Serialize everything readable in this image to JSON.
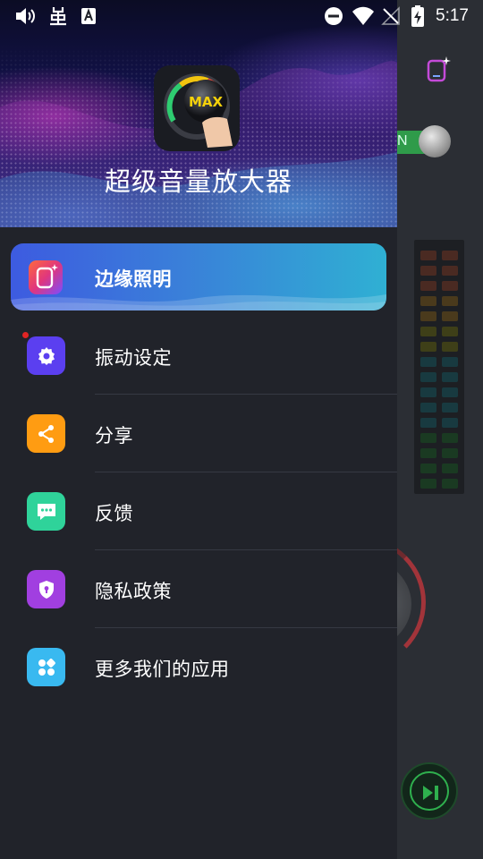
{
  "status_bar": {
    "time": "5:17",
    "left_icons": [
      "volume-icon",
      "bug-icon",
      "font-app-icon"
    ],
    "right_icons": [
      "dnd-icon",
      "wifi-icon",
      "no-signal-icon",
      "battery-charging-icon"
    ]
  },
  "drawer": {
    "app_name": "超级音量放大器",
    "logo_text": "MAX",
    "active_item": {
      "label": "边缘照明",
      "icon": "edge-lighting-icon"
    },
    "items": [
      {
        "label": "振动设定",
        "icon": "gear-icon",
        "color": "#5b3ff0",
        "has_dot": true
      },
      {
        "label": "分享",
        "icon": "share-icon",
        "color": "#ff9c12",
        "has_dot": false
      },
      {
        "label": "反馈",
        "icon": "chat-icon",
        "color": "#2fd39a",
        "has_dot": false
      },
      {
        "label": "隐私政策",
        "icon": "shield-lock-icon",
        "color": "#a13fe0",
        "has_dot": false
      },
      {
        "label": "更多我们的应用",
        "icon": "apps-grid-icon",
        "color": "#39b9f0",
        "has_dot": false
      }
    ]
  },
  "background_app": {
    "toggle_text": "N",
    "toggle_state": "on"
  },
  "colors": {
    "drawer_bg": "#21232a",
    "accent_start": "#3d5be0",
    "accent_end": "#2fb0d3"
  }
}
